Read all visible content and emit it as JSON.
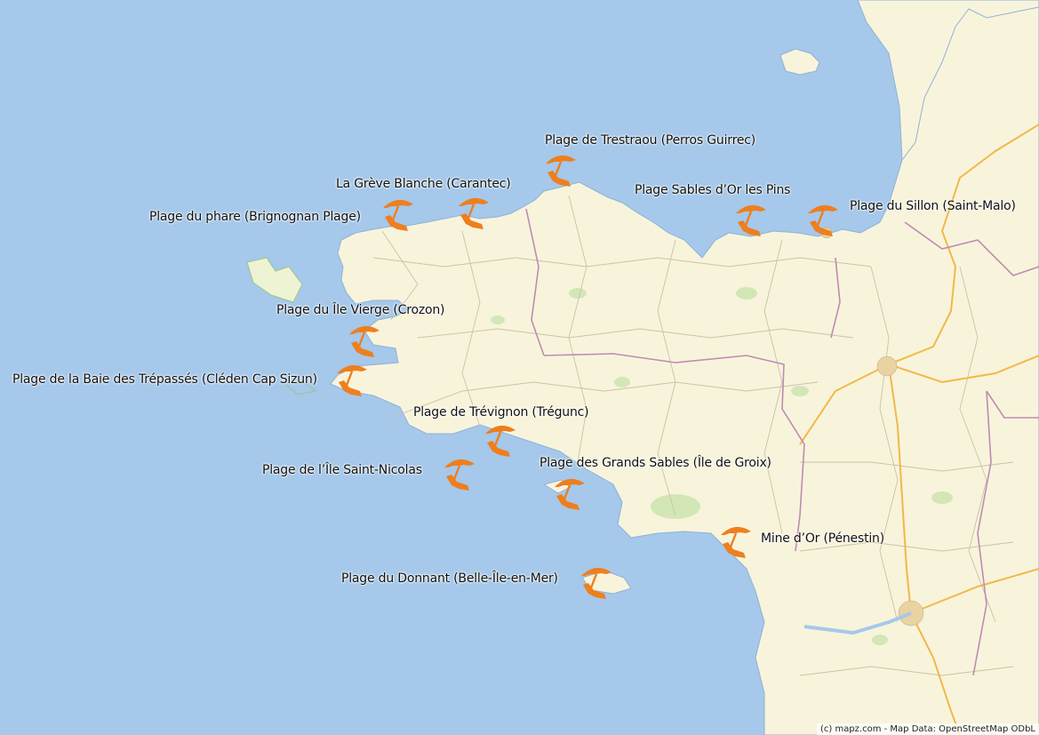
{
  "map": {
    "land_color": "#f8f4dc",
    "water_color": "#a6c8ea",
    "road_major_color": "#f2b84a",
    "border_color": "#c08bb0",
    "marker_color": "#ee7f1e",
    "marker_icon": "beach-umbrella-icon"
  },
  "beaches": [
    {
      "id": "trestraou",
      "label": "Plage de Trestraou (Perros Guirrec)"
    },
    {
      "id": "greve-blanche",
      "label": "La Grève Blanche (Carantec)"
    },
    {
      "id": "sables-dor",
      "label": "Plage Sables d’Or les Pins"
    },
    {
      "id": "sillon",
      "label": "Plage du Sillon (Saint-Malo)"
    },
    {
      "id": "phare",
      "label": "Plage du phare (Brignognan Plage)"
    },
    {
      "id": "ile-vierge",
      "label": "Plage du Île Vierge (Crozon)"
    },
    {
      "id": "trepasses",
      "label": "Plage de la Baie des Trépassés (Cléden Cap Sizun)"
    },
    {
      "id": "trevignon",
      "label": "Plage de Trévignon (Trégunc)"
    },
    {
      "id": "saint-nicolas",
      "label": "Plage de l’Île Saint-Nicolas"
    },
    {
      "id": "grands-sables",
      "label": "Plage des Grands Sables (Île de Groix)"
    },
    {
      "id": "mine-dor",
      "label": "Mine d’Or (Pénestin)"
    },
    {
      "id": "donnant",
      "label": "Plage du Donnant (Belle-Île-en-Mer)"
    }
  ],
  "attribution": "(c) mapz.com - Map Data: OpenStreetMap ODbL"
}
